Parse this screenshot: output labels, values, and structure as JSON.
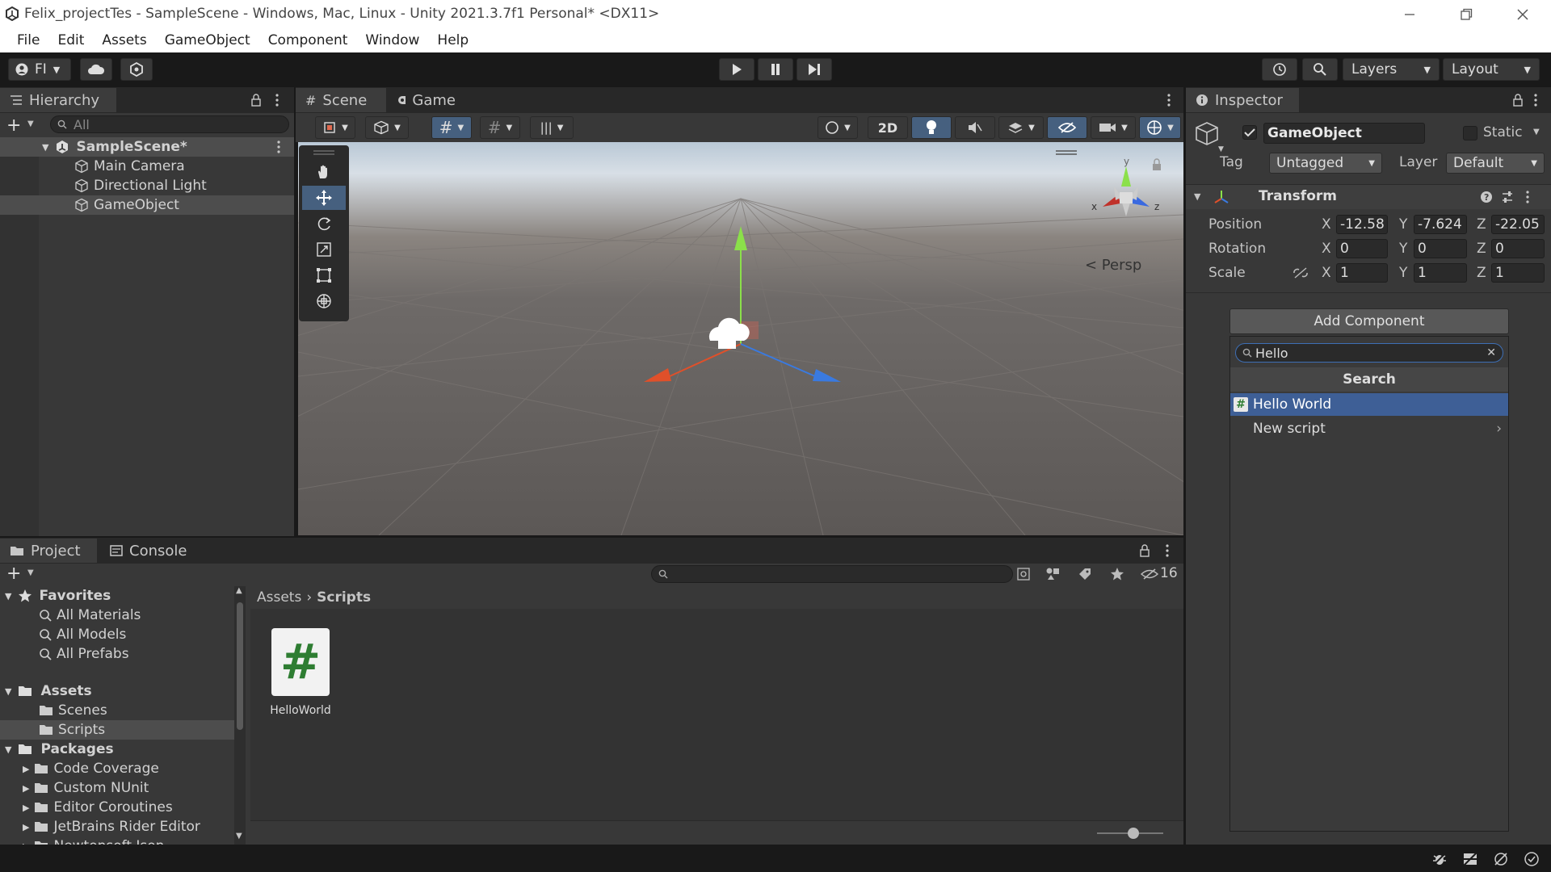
{
  "window": {
    "title": "Felix_projectTes - SampleScene - Windows, Mac, Linux - Unity 2021.3.7f1 Personal* <DX11>"
  },
  "menu": [
    "File",
    "Edit",
    "Assets",
    "GameObject",
    "Component",
    "Window",
    "Help"
  ],
  "toolbar": {
    "account_label": "FI",
    "layers_label": "Layers",
    "layout_label": "Layout"
  },
  "hierarchy": {
    "tab": "Hierarchy",
    "search_placeholder": "All",
    "scene": "SampleScene*",
    "items": [
      "Main Camera",
      "Directional Light",
      "GameObject"
    ]
  },
  "scene": {
    "tabs": [
      "Scene",
      "Game"
    ],
    "mode_2d": "2D",
    "persp_label": "< Persp",
    "axis_x": "x",
    "axis_y": "y",
    "axis_z": "z"
  },
  "inspector": {
    "tab": "Inspector",
    "object_name": "GameObject",
    "static_label": "Static",
    "tag_label": "Tag",
    "tag_value": "Untagged",
    "layer_label": "Layer",
    "layer_value": "Default",
    "transform": {
      "title": "Transform",
      "position_label": "Position",
      "rotation_label": "Rotation",
      "scale_label": "Scale",
      "position": {
        "x": "-12.58",
        "y": "-7.624",
        "z": "-22.05"
      },
      "rotation": {
        "x": "0",
        "y": "0",
        "z": "0"
      },
      "scale": {
        "x": "1",
        "y": "1",
        "z": "1"
      },
      "x": "X",
      "y": "Y",
      "z": "Z"
    },
    "add_component": {
      "button": "Add Component",
      "search_value": "Hello",
      "header": "Search",
      "results": [
        "Hello World",
        "New script"
      ]
    }
  },
  "project": {
    "tabs": [
      "Project",
      "Console"
    ],
    "hidden_count": "16",
    "breadcrumb": [
      "Assets",
      "Scripts"
    ],
    "favorites": {
      "label": "Favorites",
      "items": [
        "All Materials",
        "All Models",
        "All Prefabs"
      ]
    },
    "assets": {
      "label": "Assets",
      "items": [
        "Scenes",
        "Scripts"
      ]
    },
    "packages": {
      "label": "Packages",
      "items": [
        "Code Coverage",
        "Custom NUnit",
        "Editor Coroutines",
        "JetBrains Rider Editor",
        "Newtonsoft Json"
      ]
    },
    "files": [
      {
        "name": "HelloWorld",
        "icon": "#"
      }
    ]
  },
  "colors": {
    "accent": "#3e5f96",
    "bg": "#383838",
    "dark": "#282828"
  }
}
